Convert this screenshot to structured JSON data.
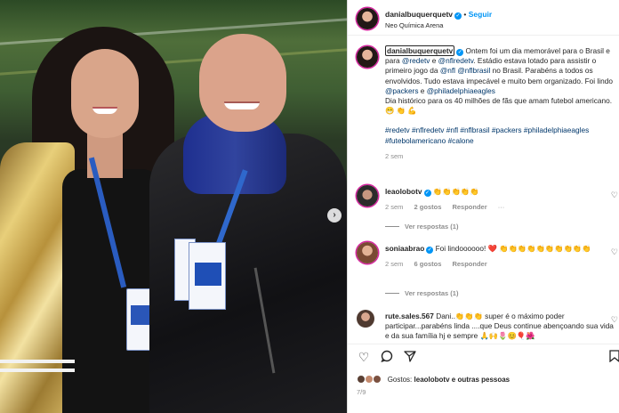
{
  "post": {
    "username": "danialbuquerquetv",
    "follow_label": "Seguir",
    "location": "Neo Química Arena",
    "caption_text": "Ontem foi um dia memorável para o Brasil e para",
    "caption_m1": "@redetv",
    "caption_and": "e",
    "caption_m2": "@nflredetv",
    "caption_mid": ". Estádio estava lotado para assistir o primeiro jogo da",
    "caption_m3": "@nfl",
    "caption_m4": "@nflbrasil",
    "caption_rest": "no Brasil. Parabéns a todos os envolvidos. Tudo estava impecável e muito bem organizado. Foi lindo",
    "caption_m5": "@packers",
    "caption_e2": "e",
    "caption_m6": "@philadelphiaeagles",
    "caption_end": "Dia histórico para os 40 milhões de fãs que amam futebol americano. 😁 👏 💪",
    "hashtags": "#redetv #nflredetv #nfl #nflbrasil #packers #philadelphiaeagles #futebolamericano #calone",
    "time": "2 sem"
  },
  "comments": [
    {
      "username": "leaolobotv",
      "text": "👏👏👏👏👏",
      "time": "2 sem",
      "likes": "2 gostos",
      "reply": "Responder",
      "more": "···",
      "view_replies": "Ver respostas (1)"
    },
    {
      "username": "soniaabrao",
      "text": "Foi lindoooooo! ❤️ 👏👏👏👏👏👏👏👏👏👏",
      "time": "2 sem",
      "likes": "6 gostos",
      "reply": "Responder",
      "view_replies": "Ver respostas (1)"
    },
    {
      "username": "rute.sales.567",
      "text": "Dani..👏👏👏 super é o máximo poder participar...parabéns linda ....que Deus continue abençoando sua vida e da sua família hj e sempre 🙏🙌🌷😊🎈🌺"
    }
  ],
  "footer": {
    "liked_prefix": "Gostos:",
    "liked_user": "leaolobotv",
    "liked_suffix": "e outras pessoas",
    "pager": "7/9"
  }
}
